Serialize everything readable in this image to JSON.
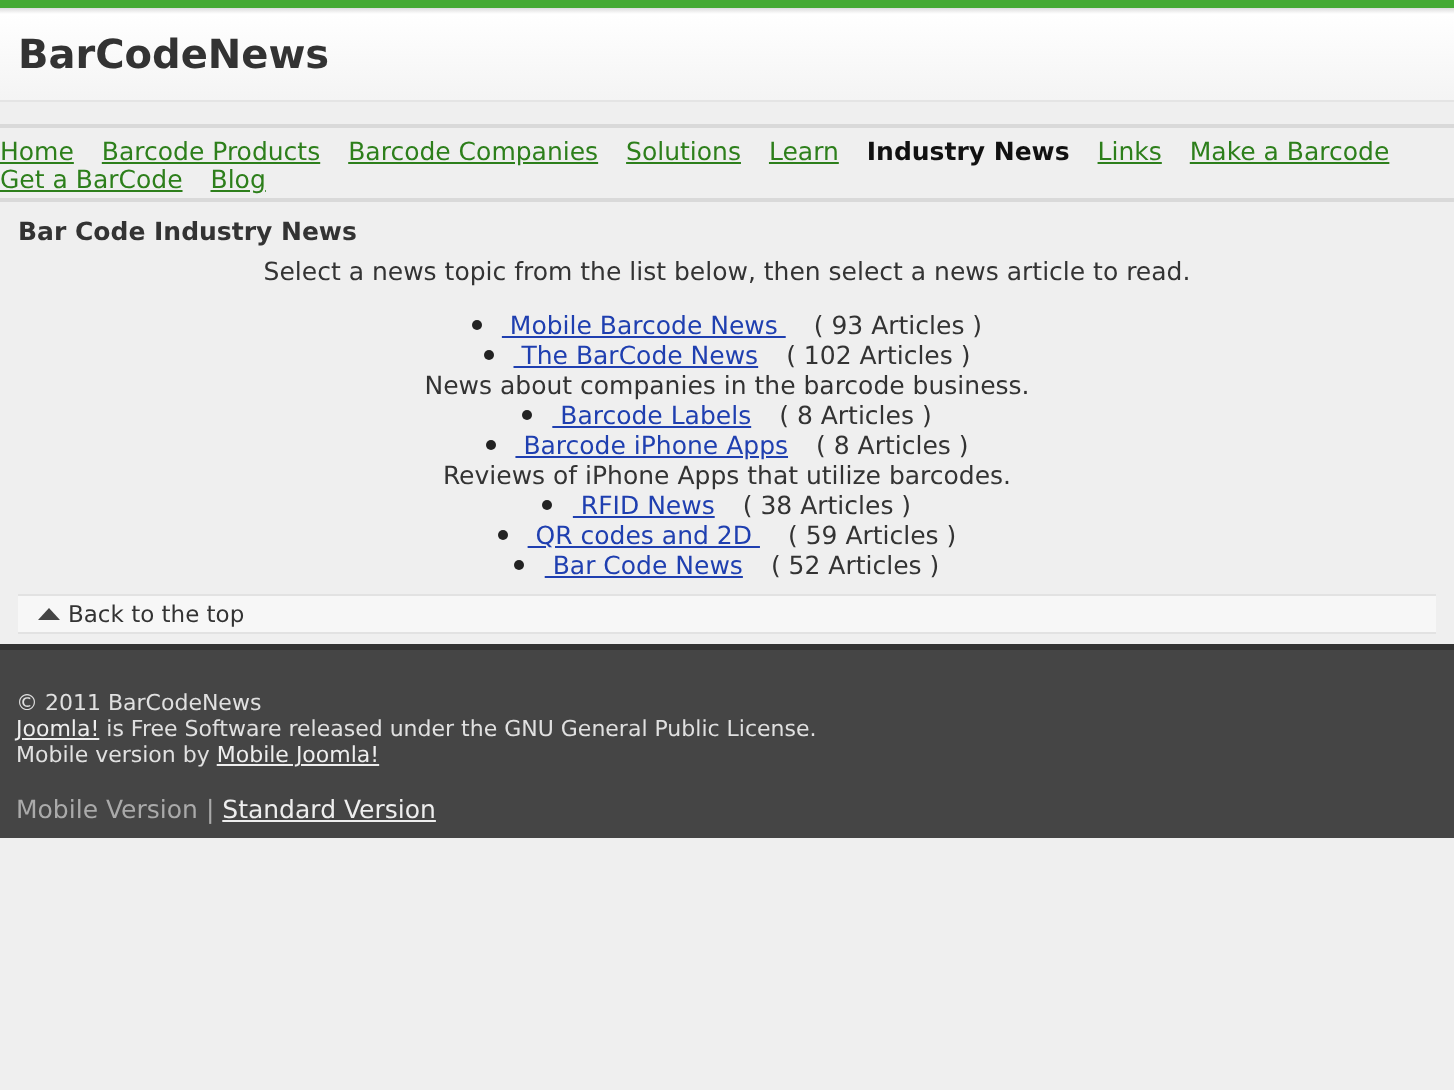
{
  "site_title": "BarCodeNews",
  "nav": [
    {
      "label": "Home",
      "selected": false
    },
    {
      "label": "Barcode Products",
      "selected": false
    },
    {
      "label": "Barcode Companies",
      "selected": false
    },
    {
      "label": "Solutions",
      "selected": false
    },
    {
      "label": "Learn",
      "selected": false
    },
    {
      "label": "Industry News",
      "selected": true
    },
    {
      "label": "Links",
      "selected": false
    },
    {
      "label": "Make a Barcode",
      "selected": false
    },
    {
      "label": "Get a BarCode",
      "selected": false
    },
    {
      "label": "Blog",
      "selected": false
    }
  ],
  "heading": "Bar Code Industry News",
  "intro": "Select a news topic from the list below, then select a news article to read.",
  "topics": [
    {
      "title": " Mobile Barcode News ",
      "count": "( 93 Articles )"
    },
    {
      "title": " The BarCode News",
      "count": "( 102 Articles )",
      "description": "News about companies in the barcode business."
    },
    {
      "title": " Barcode Labels",
      "count": "( 8 Articles )"
    },
    {
      "title": " Barcode iPhone Apps",
      "count": "( 8 Articles )",
      "description": "Reviews of iPhone Apps that utilize barcodes."
    },
    {
      "title": " RFID News",
      "count": "( 38 Articles )"
    },
    {
      "title": " QR codes and 2D ",
      "count": "( 59 Articles )"
    },
    {
      "title": " Bar Code News",
      "count": "( 52 Articles )"
    }
  ],
  "back_to_top": "Back to the top",
  "footer": {
    "copyright": "© 2011 BarCodeNews",
    "license_link": "Joomla!",
    "license_text": " is Free Software released under the GNU General Public License.",
    "mobile_text": "Mobile version by ",
    "mobile_link": "Mobile Joomla!",
    "current_version": "Mobile Version",
    "separator": "|",
    "other_version": "Standard Version"
  }
}
